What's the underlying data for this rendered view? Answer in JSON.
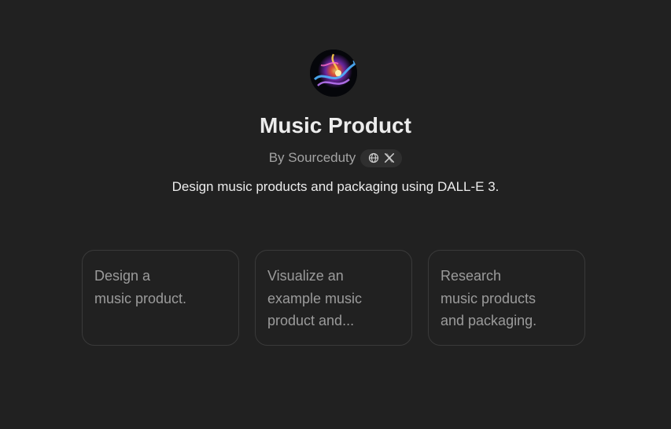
{
  "gpt": {
    "title": "Music Product",
    "author": "By Sourceduty",
    "description": "Design music products and packaging using DALL-E 3.",
    "avatar_icon": "swirl-art-icon"
  },
  "social": {
    "icons": [
      "globe-icon",
      "x-logo-icon"
    ]
  },
  "starters": [
    {
      "text": "Design a\nmusic product."
    },
    {
      "text": "Visualize an\nexample music\nproduct and..."
    },
    {
      "text": "Research\nmusic products\nand packaging."
    }
  ],
  "colors": {
    "background": "#212121",
    "card_border": "#3a3a3a",
    "pill_background": "#2f2f2f",
    "text_primary": "#ececec",
    "text_muted": "#a3a3a3"
  }
}
